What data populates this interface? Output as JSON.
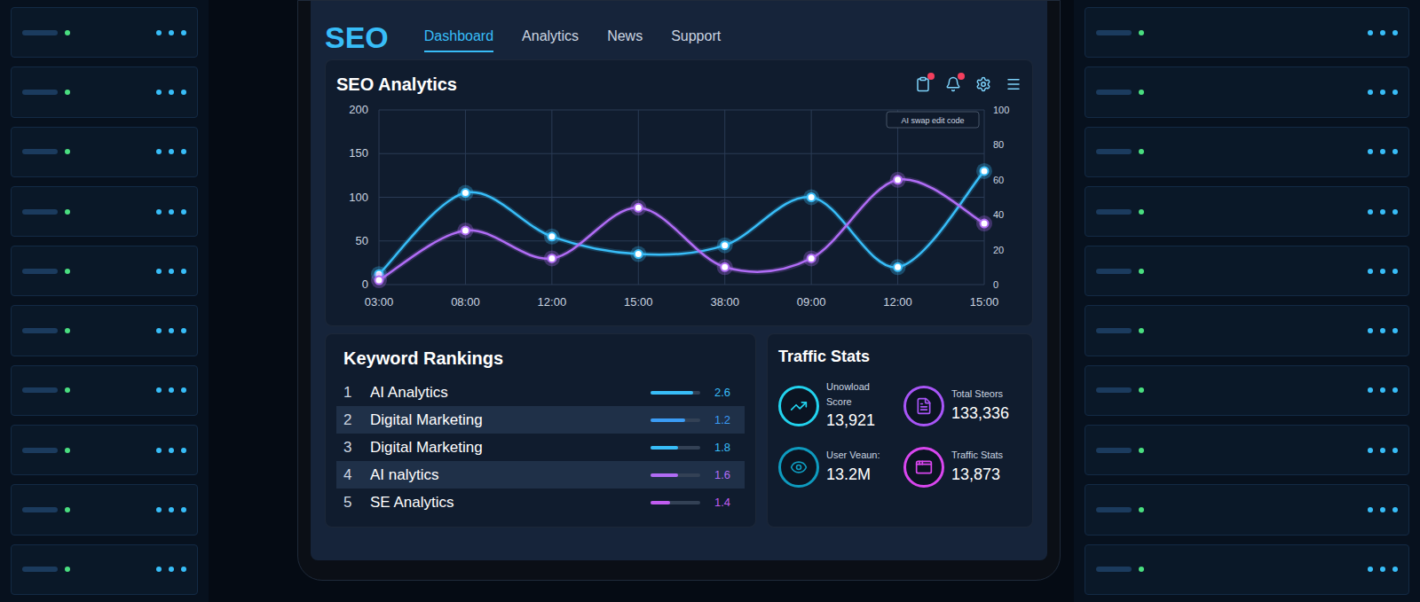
{
  "logo": "SEO",
  "nav": [
    {
      "label": "Dashboard",
      "selected": true
    },
    {
      "label": "Analytics",
      "selected": false
    },
    {
      "label": "News",
      "selected": false
    },
    {
      "label": "Support",
      "selected": false
    }
  ],
  "header_icons": [
    {
      "badge": true
    },
    {
      "badge": true
    },
    {
      "badge": false
    },
    {
      "badge": false
    }
  ],
  "chart": {
    "title": "SEO Analytics",
    "legend_label": "AI swap edit code",
    "y_ticks_left": [
      "0",
      "50",
      "100",
      "150",
      "200"
    ],
    "y_ticks_right": [
      "0",
      "20",
      "40",
      "60",
      "80",
      "100"
    ],
    "x_labels": [
      "03:00",
      "08:00",
      "12:00",
      "15:00",
      "38:00",
      "09:00",
      "12:00",
      "15:00"
    ],
    "series": [
      {
        "color": "#38bdf8",
        "values": [
          12,
          105,
          55,
          35,
          45,
          100,
          20,
          130
        ]
      },
      {
        "color": "#b06cf5",
        "values": [
          5,
          62,
          30,
          88,
          20,
          30,
          120,
          70
        ]
      }
    ]
  },
  "keywords": {
    "title": "Keyword Rankings",
    "rows": [
      {
        "rank": "1",
        "name": "AI Analytics",
        "score": "2.6",
        "level": 0.85,
        "color": "#38bdf8"
      },
      {
        "rank": "2",
        "name": "Digital Marketing",
        "score": "1.2",
        "level": 0.7,
        "color": "#3b9cf5"
      },
      {
        "rank": "3",
        "name": "Digital Marketing",
        "score": "1.8",
        "level": 0.55,
        "color": "#38bdf8"
      },
      {
        "rank": "4",
        "name": "AI nalytics",
        "score": "1.6",
        "level": 0.55,
        "color": "#b06cf5"
      },
      {
        "rank": "5",
        "name": "SE Analytics",
        "score": "1.4",
        "level": 0.4,
        "color": "#c05cf0"
      }
    ]
  },
  "traffic": {
    "title": "Traffic Stats",
    "stats": [
      {
        "label": "Unowload Score",
        "value": "13,921",
        "color": "#22d3ee"
      },
      {
        "label": "Total Steors",
        "value": "133,336",
        "color": "#a855f7"
      },
      {
        "label": "User Veaun:",
        "value": "13.2M",
        "color": "#0e9bbf"
      },
      {
        "label": "Traffic Stats",
        "value": "13,873",
        "color": "#d946ef"
      }
    ]
  }
}
